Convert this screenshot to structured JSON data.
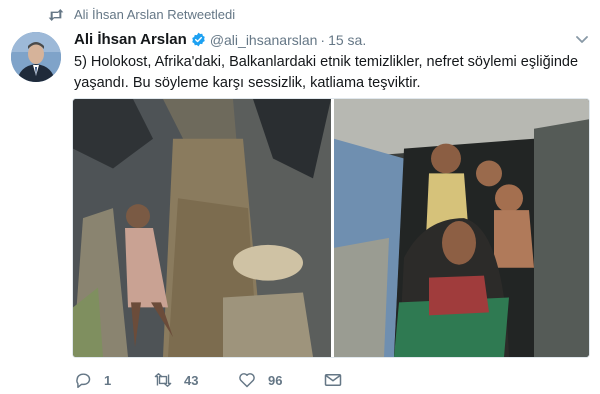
{
  "retweet_banner": {
    "text": "Ali İhsan Arslan Retweetledi",
    "icon": "retweet-icon"
  },
  "tweet": {
    "author": {
      "display_name": "Ali İhsan Arslan",
      "handle": "@ali_ihsanarslan",
      "verified": true,
      "avatar_icon": "avatar"
    },
    "separator": "·",
    "time": "15 sa.",
    "text": "5) Holokost, Afrika'daki, Balkanlardaki etnik temizlikler, nefret söylemi eşliğinde yaşandı. Bu söyleme karşı sessizlik, katliama teşviktir.",
    "media": [
      {
        "name": "photo-trench-child"
      },
      {
        "name": "photo-family-shelter"
      }
    ],
    "actions": {
      "reply_count": "1",
      "retweet_count": "43",
      "like_count": "96"
    }
  },
  "colors": {
    "text_primary": "#14171a",
    "text_secondary": "#657786",
    "verified_blue": "#1da1f2",
    "divider": "#e1e8ed"
  }
}
